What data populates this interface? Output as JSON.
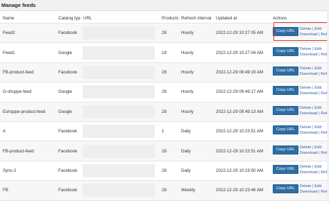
{
  "page": {
    "title": "Manage feeds"
  },
  "columns": {
    "name": "Name",
    "catalog_type": "Catalog type",
    "url": "URL",
    "products": "Products",
    "refresh_interval": "Refresh interval",
    "updated_at": "Updated at",
    "actions": "Actions"
  },
  "actions": {
    "copy_url": "Copy URL",
    "delete": "Delete",
    "edit": "Edit",
    "download": "Download",
    "refresh": "Refresh",
    "separator": "|"
  },
  "feeds": [
    {
      "name": "Feed2",
      "catalog_type": "Facebook",
      "products": "28",
      "refresh_interval": "Hourly",
      "updated_at": "2022-12-29 10:27:05 AM"
    },
    {
      "name": "Feed1",
      "catalog_type": "Google",
      "products": "19",
      "refresh_interval": "Hourly",
      "updated_at": "2022-12-29 10:27:04 AM"
    },
    {
      "name": "FB-product-feed",
      "catalog_type": "Facebook",
      "products": "28",
      "refresh_interval": "Hourly",
      "updated_at": "2022-12-29 09:49:19 AM"
    },
    {
      "name": "G-shoppe-feed",
      "catalog_type": "Google",
      "products": "28",
      "refresh_interval": "Hourly",
      "updated_at": "2022-12-29 09:49:17 AM"
    },
    {
      "name": "Eshoppe-product-feed",
      "catalog_type": "Google",
      "products": "28",
      "refresh_interval": "Hourly",
      "updated_at": "2022-12-29 09:49:13 AM"
    },
    {
      "name": "A",
      "catalog_type": "Facebook",
      "products": "1",
      "refresh_interval": "Daily",
      "updated_at": "2022-12-29 10:23:51 AM"
    },
    {
      "name": "FB-product-feed",
      "catalog_type": "Facebook",
      "products": "28",
      "refresh_interval": "Daily",
      "updated_at": "2022-12-29 10:23:51 AM"
    },
    {
      "name": "Sync-2",
      "catalog_type": "Facebook",
      "products": "28",
      "refresh_interval": "Daily",
      "updated_at": "2022-12-29 10:23:50 AM"
    },
    {
      "name": "FB",
      "catalog_type": "Facebook",
      "products": "28",
      "refresh_interval": "Weekly",
      "updated_at": "2022-12-29 10:23:46 AM"
    }
  ]
}
